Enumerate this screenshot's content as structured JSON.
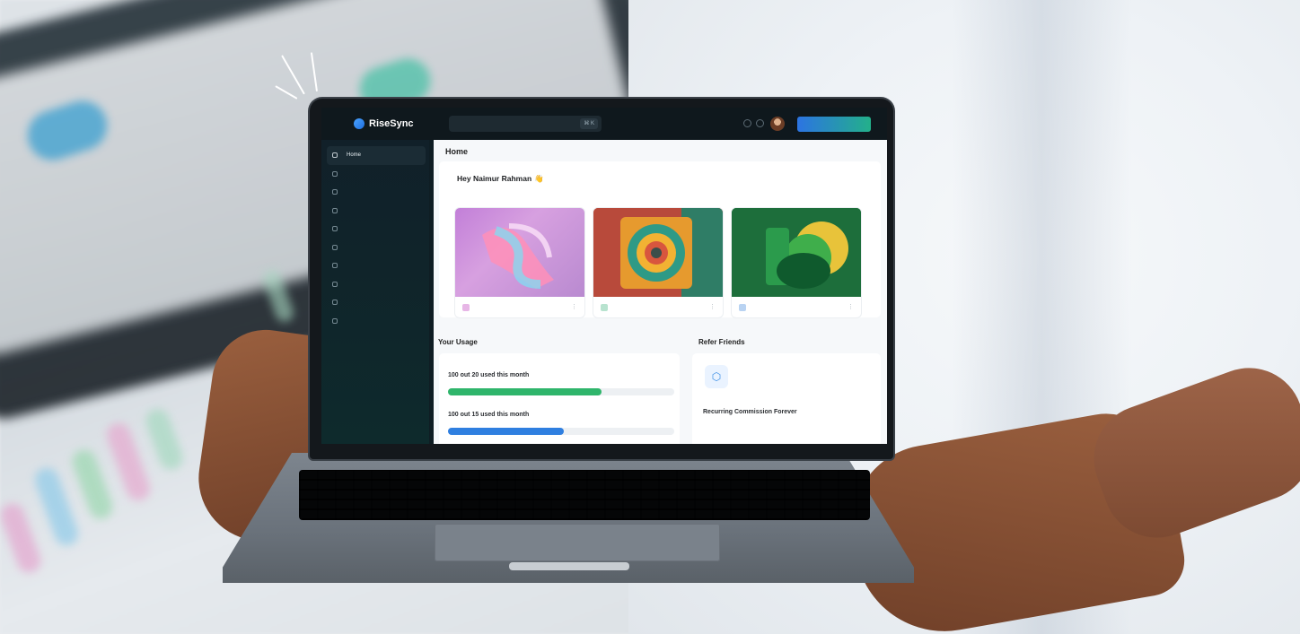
{
  "app": {
    "brand": "RiseSync",
    "search_placeholder": "",
    "search_shortcut": "⌘ K",
    "cta_label": ""
  },
  "sidebar": {
    "items": [
      {
        "label": "Home",
        "active": true,
        "icon": "home-icon"
      },
      {
        "label": "",
        "active": false,
        "icon": "grid-icon"
      },
      {
        "label": "",
        "active": false,
        "icon": "tools-icon"
      },
      {
        "label": "",
        "active": false,
        "icon": "chart-icon"
      },
      {
        "label": "",
        "active": false,
        "icon": "file-icon"
      },
      {
        "label": "",
        "active": false,
        "icon": "globe-icon"
      },
      {
        "label": "",
        "active": false,
        "icon": "users-icon"
      },
      {
        "label": "",
        "active": false,
        "icon": "card-icon"
      },
      {
        "label": "",
        "active": false,
        "icon": "support-icon"
      },
      {
        "label": "",
        "active": false,
        "icon": "help-icon"
      }
    ]
  },
  "main": {
    "page_title": "Home",
    "greeting": "Hey Naimur Rahman",
    "greeting_emoji": "👋",
    "subline": "",
    "templates": [
      {
        "name": "",
        "icon_color": "#e7b6e6",
        "art": "pink"
      },
      {
        "name": "",
        "icon_color": "#b8e3cf",
        "art": "orange"
      },
      {
        "name": "",
        "icon_color": "#b9d3f2",
        "art": "green"
      }
    ],
    "usage": {
      "title": "Your Usage",
      "items": [
        {
          "kicker": "",
          "text": "100 out 20 used this month",
          "fraction": 0.68,
          "color": "#2fb56b"
        },
        {
          "kicker": "",
          "text": "100 out 15 used this month",
          "fraction": 0.51,
          "color": "#2f7fe0"
        }
      ]
    },
    "refer": {
      "title": "Refer Friends",
      "kicker": "",
      "heading": "Recurring Commission Forever",
      "description": ""
    }
  }
}
